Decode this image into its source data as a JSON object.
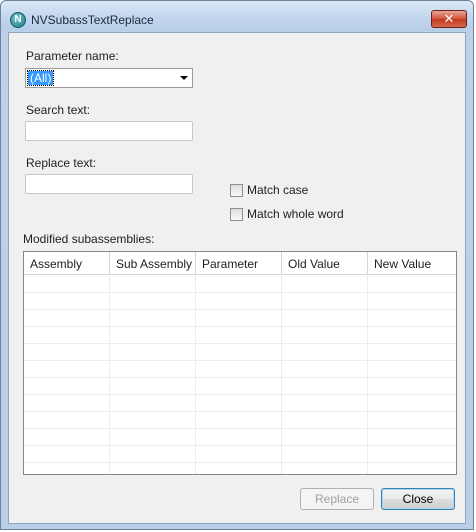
{
  "window": {
    "title": "NVSubassTextReplace",
    "app_icon_glyph": "N",
    "close_glyph": "✕"
  },
  "form": {
    "parameter_name_label": "Parameter name:",
    "parameter_name_value": "(All)",
    "search_text_label": "Search text:",
    "search_text_value": "",
    "replace_text_label": "Replace text:",
    "replace_text_value": "",
    "match_case_label": "Match case",
    "match_case_checked": false,
    "match_whole_word_label": "Match whole word",
    "match_whole_word_checked": false
  },
  "grid": {
    "label": "Modified subassemblies:",
    "columns": [
      "Assembly",
      "Sub Assembly",
      "Parameter",
      "Old Value",
      "New Value"
    ],
    "rows": []
  },
  "buttons": {
    "replace_label": "Replace",
    "replace_enabled": false,
    "close_label": "Close"
  }
}
